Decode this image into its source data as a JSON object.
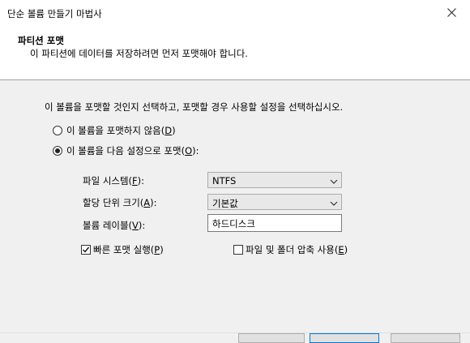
{
  "window": {
    "title": "단순 볼륨 만들기 마법사",
    "close_icon": "close-icon"
  },
  "header": {
    "title": "파티션 포맷",
    "subtitle": "이 파티션에 데이터를 저장하려면 먼저 포맷해야 합니다."
  },
  "instruction": "이 볼륨을 포맷할 것인지 선택하고, 포맷할 경우 사용할 설정을 선택하십시오.",
  "options": {
    "no_format": {
      "label": "이 볼륨을 포맷하지 않음(",
      "key": "D",
      "end": ")",
      "selected": false
    },
    "format": {
      "label": "이 볼륨을 다음 설정으로 포맷(",
      "key": "O",
      "end": "):",
      "selected": true
    }
  },
  "settings": {
    "file_system": {
      "label": "파일 시스템(",
      "key": "F",
      "end": "):",
      "value": "NTFS"
    },
    "alloc_unit": {
      "label": "할당 단위 크기(",
      "key": "A",
      "end": "):",
      "value": "기본값"
    },
    "volume_label": {
      "label": "볼륨 레이블(",
      "key": "V",
      "end": "):",
      "value": "하드디스크"
    }
  },
  "checkboxes": {
    "quick_format": {
      "label": "빠른 포맷 실행(",
      "key": "P",
      "end": ")",
      "checked": true
    },
    "compression": {
      "label": "파일 및 폴더 압축 사용(",
      "key": "E",
      "end": ")",
      "checked": false
    }
  }
}
